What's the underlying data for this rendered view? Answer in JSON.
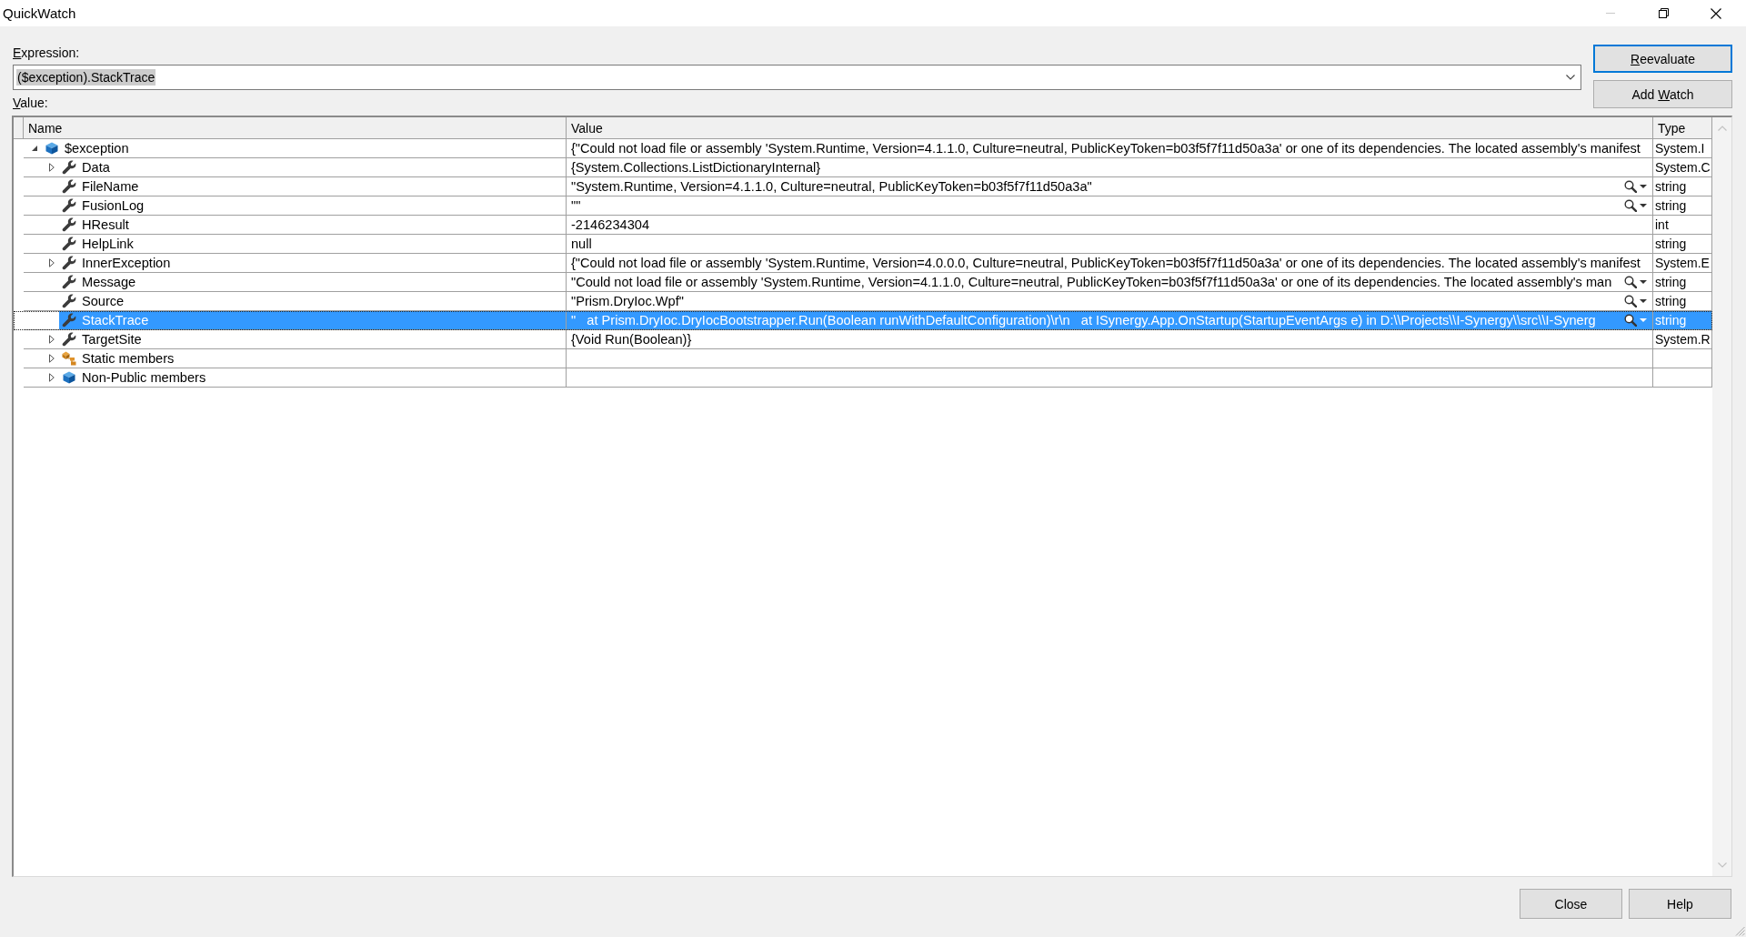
{
  "window": {
    "title": "QuickWatch",
    "minimize_disabled": true
  },
  "expression": {
    "label_parts": [
      {
        "text": "E",
        "underlined": true
      },
      {
        "text": "xpression:",
        "underlined": false
      }
    ],
    "value": "($exception).StackTrace",
    "value_highlighted": true
  },
  "value_label": {
    "label_parts": [
      {
        "text": "V",
        "underlined": true
      },
      {
        "text": "alue:",
        "underlined": false
      }
    ]
  },
  "side_buttons": [
    {
      "label_parts": [
        {
          "text": "R",
          "underlined": true
        },
        {
          "text": "eevaluate",
          "underlined": false
        }
      ],
      "default": true
    },
    {
      "label_parts": [
        {
          "text": "Add ",
          "underlined": false
        },
        {
          "text": "W",
          "underlined": true
        },
        {
          "text": "atch",
          "underlined": false
        }
      ],
      "default": false
    }
  ],
  "grid": {
    "columns": [
      "Name",
      "Value",
      "Type"
    ],
    "rows": [
      {
        "name": "$exception",
        "kind": "object",
        "value": "{\"Could not load file or assembly 'System.Runtime, Version=4.1.1.0, Culture=neutral, PublicKeyToken=b03f5f7f11d50a3a' or one of its dependencies. The located assembly's manifest",
        "type": "System.I",
        "expanded": true,
        "selected": false,
        "visualizer": false,
        "children": [
          {
            "name": "Data",
            "kind": "property",
            "value": "{System.Collections.ListDictionaryInternal}",
            "type": "System.C",
            "expanded": false,
            "selected": false,
            "visualizer": false
          },
          {
            "name": "FileName",
            "kind": "property",
            "value": "\"System.Runtime, Version=4.1.1.0, Culture=neutral, PublicKeyToken=b03f5f7f11d50a3a\"",
            "type": "string",
            "selected": false,
            "visualizer": true
          },
          {
            "name": "FusionLog",
            "kind": "property",
            "value": "\"\"",
            "type": "string",
            "selected": false,
            "visualizer": true
          },
          {
            "name": "HResult",
            "kind": "property",
            "value": "-2146234304",
            "type": "int",
            "selected": false,
            "visualizer": false
          },
          {
            "name": "HelpLink",
            "kind": "property",
            "value": "null",
            "type": "string",
            "selected": false,
            "visualizer": false
          },
          {
            "name": "InnerException",
            "kind": "property",
            "value": "{\"Could not load file or assembly 'System.Runtime, Version=4.0.0.0, Culture=neutral, PublicKeyToken=b03f5f7f11d50a3a' or one of its dependencies. The located assembly's manifest",
            "type": "System.E",
            "expanded": false,
            "selected": false,
            "visualizer": false
          },
          {
            "name": "Message",
            "kind": "property",
            "value": "\"Could not load file or assembly 'System.Runtime, Version=4.1.1.0, Culture=neutral, PublicKeyToken=b03f5f7f11d50a3a' or one of its dependencies. The located assembly's man",
            "type": "string",
            "selected": false,
            "visualizer": true
          },
          {
            "name": "Source",
            "kind": "property",
            "value": "\"Prism.DryIoc.Wpf\"",
            "type": "string",
            "selected": false,
            "visualizer": true
          },
          {
            "name": "StackTrace",
            "kind": "property",
            "value": "\"   at Prism.DryIoc.DryIocBootstrapper.Run(Boolean runWithDefaultConfiguration)\\r\\n   at ISynergy.App.OnStartup(StartupEventArgs e) in D:\\\\Projects\\\\I-Synergy\\\\src\\\\I-Synerg",
            "type": "string",
            "selected": true,
            "visualizer": true
          },
          {
            "name": "TargetSite",
            "kind": "property",
            "value": "{Void Run(Boolean)}",
            "type": "System.R",
            "expanded": false,
            "selected": false,
            "visualizer": false
          },
          {
            "name": "Static members",
            "kind": "static",
            "expanded": false,
            "selected": false,
            "visualizer": false
          },
          {
            "name": "Non-Public members",
            "kind": "object",
            "expanded": false,
            "selected": false,
            "visualizer": false
          }
        ]
      }
    ]
  },
  "buttons": [
    {
      "label": "Close",
      "default": false
    },
    {
      "label": "Help",
      "default": false
    }
  ]
}
